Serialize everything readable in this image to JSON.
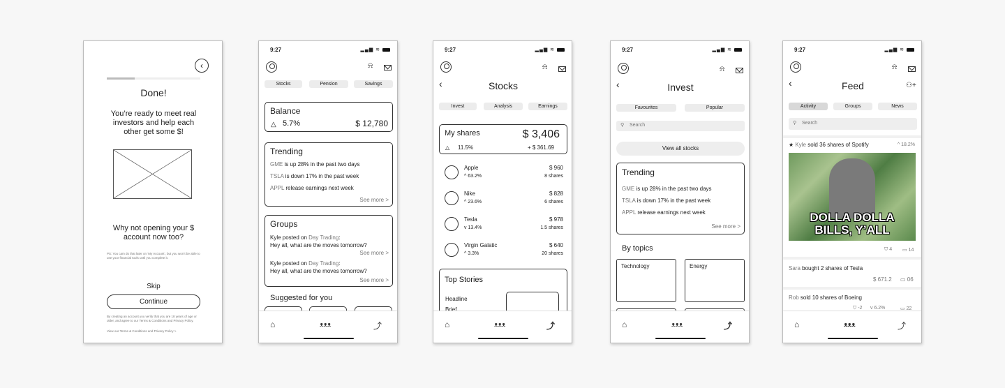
{
  "s1": {
    "title": "Done!",
    "message": "You’re ready to meet real investors and help each other get some $!",
    "question": "Why not opening your $ account now too?",
    "ps": "PS: You cam do that later on ‘My Account’, but you won’t be able to use your financial tools until you complete it.",
    "skip": "Skip",
    "continue": "Continue",
    "legal": "By creating an account you verify that you are 18 years of age or older, and agree to our Terms & Conditions and Privacy Policy.",
    "legal_link": "View our Terms & Conditions and Privacy Policy >"
  },
  "s2": {
    "time": "9:27",
    "tabs": [
      "Stocks",
      "Pension",
      "Savings"
    ],
    "balance_label": "Balance",
    "balance_change": "5.7%",
    "balance_value": "$ 12,780",
    "trending_title": "Trending",
    "trending": [
      {
        "ticker": "GME",
        "text": " is up 28% in the past two days"
      },
      {
        "ticker": "TSLA",
        "text": " is down 17% in the past week"
      },
      {
        "ticker": "APPL",
        "text": " release earnings next week"
      }
    ],
    "see_more": "See more >",
    "groups_title": "Groups",
    "posts": [
      {
        "user": "Kyle",
        "mid": " posted on ",
        "group": "Day Trading",
        "colon": ":",
        "msg": "Hey all, what are the moves tomorrow?"
      },
      {
        "user": "Kyle",
        "mid": " posted on ",
        "group": "Day Trading",
        "colon": ":",
        "msg": "Hey all, what are the moves tomorrow?"
      }
    ],
    "suggested": "Suggested for you"
  },
  "s3": {
    "time": "9:27",
    "title": "Stocks",
    "tabs": [
      "Invest",
      "Analysis",
      "Earnings"
    ],
    "myshares_label": "My shares",
    "myshares_value": "$ 3,406",
    "myshares_pct": "11.5%",
    "myshares_gain": "+ $ 361.69",
    "stocks": [
      {
        "name": "Apple",
        "change": "63.2%",
        "dir": "up",
        "price": "$ 960",
        "shares": "8 shares"
      },
      {
        "name": "Nike",
        "change": "23.6%",
        "dir": "up",
        "price": "$ 828",
        "shares": "6 shares"
      },
      {
        "name": "Tesla",
        "change": "13.4%",
        "dir": "down",
        "price": "$ 978",
        "shares": "1.5 shares"
      },
      {
        "name": "Virgin Galatic",
        "change": "3.3%",
        "dir": "up",
        "price": "$ 640",
        "shares": "20 shares"
      }
    ],
    "top_stories": "Top Stories",
    "headline": "Headline",
    "brief": "Brief"
  },
  "s4": {
    "time": "9:27",
    "title": "Invest",
    "tabs": [
      "Favourites",
      "Popular"
    ],
    "search": "Search",
    "view_all": "View all stocks",
    "trending_title": "Trending",
    "trending": [
      {
        "ticker": "GME",
        "text": " is up 28% in the past two days"
      },
      {
        "ticker": "TSLA",
        "text": " is down 17% in the past week"
      },
      {
        "ticker": "APPL",
        "text": " release earnings next week"
      }
    ],
    "see_more": "See more >",
    "by_topics": "By topics",
    "topics": [
      "Technology",
      "Energy"
    ]
  },
  "s5": {
    "time": "9:27",
    "title": "Feed",
    "tabs": [
      "Activity",
      "Groups",
      "News"
    ],
    "search": "Search",
    "post1": {
      "star": "★",
      "user": "Kyle",
      "text": " sold 36 shares of Spotify",
      "pct": "18.2%",
      "img_text": "DOLLA DOLLA BILLS, Y’ALL",
      "likes": "4",
      "comments": "14"
    },
    "post2": {
      "user": "Sara",
      "text": " bought 2 shares of Tesla",
      "value": "$ 671.2",
      "comments": "06"
    },
    "post3": {
      "user": "Rob",
      "text": " sold 10 shares of Boeing",
      "likes": "-2",
      "pct": "6.2%",
      "comments": "22"
    }
  },
  "colors": {
    "accent": "#222222",
    "muted": "#777777",
    "pill": "#ececec"
  }
}
